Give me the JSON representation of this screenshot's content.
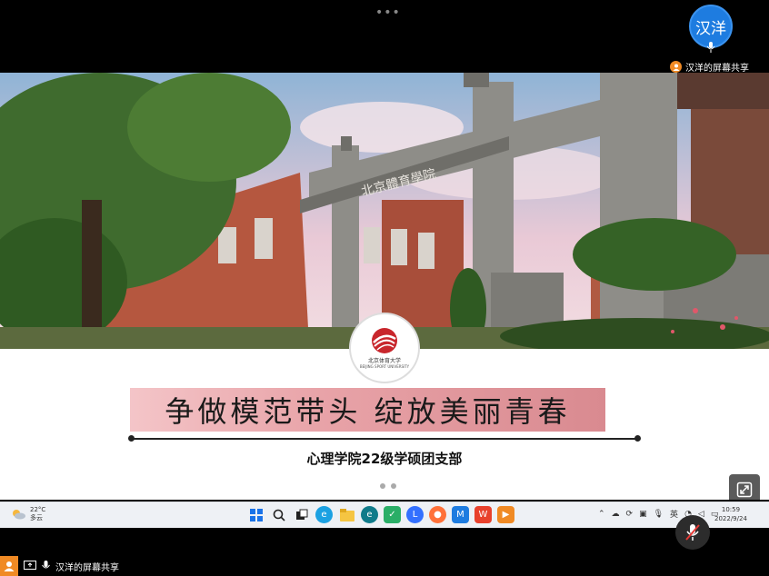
{
  "top_bar": {
    "more_menu": "•••",
    "presenter_name": "汉洋",
    "share_label": "汉洋的屏幕共享"
  },
  "slide": {
    "banner_text": "争做模范带头  绽放美丽青春",
    "subtitle": "心理学院22级学硕团支部",
    "logo_title": "北京体育大学",
    "logo_subtitle": "BEIJING SPORT UNIVERSITY",
    "photo_caption": "北京體育學院"
  },
  "taskbar": {
    "weather_temp": "22°C",
    "weather_desc": "多云",
    "ime_label": "英",
    "time": "10:59",
    "date": "2022/9/24",
    "apps": [
      "start-icon",
      "search-icon",
      "task-view-icon",
      "edge-icon",
      "file-explorer-icon",
      "edge-browser-icon",
      "wechat-icon",
      "lark-icon",
      "firefox-icon",
      "meeting-icon",
      "wps-icon",
      "slides-icon"
    ]
  },
  "bottom_bar": {
    "share_label": "汉洋的屏幕共享"
  },
  "colors": {
    "accent": "#1e7ce0",
    "orange": "#f08a24",
    "banner": "#e8a3a8"
  }
}
